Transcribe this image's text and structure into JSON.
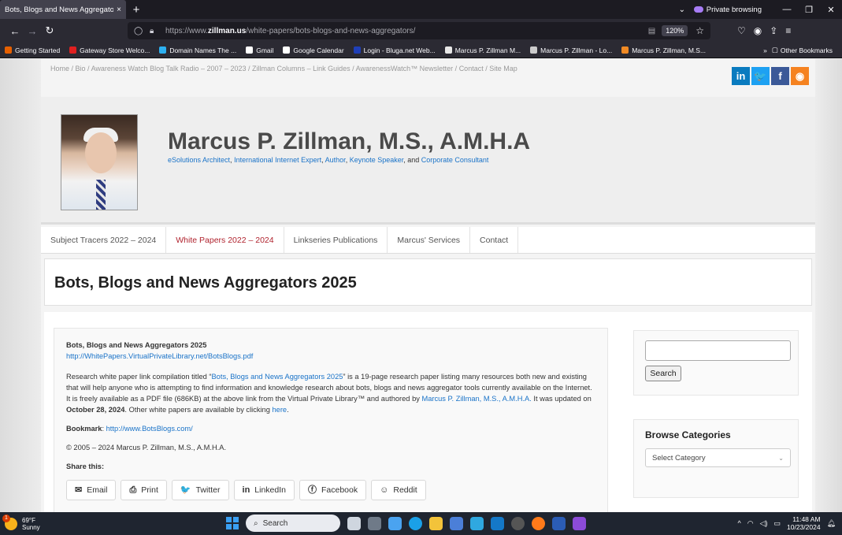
{
  "browser": {
    "tab_title": "Bots, Blogs and News Aggregators",
    "tab_close": "×",
    "new_tab": "+",
    "private_label": "Private browsing",
    "url_prefix": "https://www.",
    "url_domain": "zillman.us",
    "url_path": "/white-papers/bots-blogs-and-news-aggregators/",
    "zoom": "120%",
    "bookmarks": [
      {
        "label": "Getting Started",
        "color": "#e66000"
      },
      {
        "label": "Gateway Store Welco...",
        "color": "#e02020"
      },
      {
        "label": "Domain Names The ...",
        "color": "#2db0f0"
      },
      {
        "label": "Gmail",
        "color": "#ffffff"
      },
      {
        "label": "Google Calendar",
        "color": "#ffffff"
      },
      {
        "label": "Login - Bluga.net Web...",
        "color": "#1f3fb8"
      },
      {
        "label": "Marcus P. Zillman M...",
        "color": "#e8e8e8"
      },
      {
        "label": "Marcus P. Zillman - Lo...",
        "color": "#cccccc"
      },
      {
        "label": "Marcus P. Zillman, M.S...",
        "color": "#f08a24"
      }
    ],
    "other_bookmarks": "Other Bookmarks"
  },
  "site": {
    "topnav": [
      "Home",
      "Bio",
      "Awareness Watch Blog Talk Radio – 2007 – 2023",
      "Zillman Columns – Link Guides",
      "AwarenessWatch™ Newsletter",
      "Contact",
      "Site Map"
    ],
    "social": [
      {
        "name": "linkedin-icon",
        "glyph": "in",
        "color": "#0a7bbf"
      },
      {
        "name": "twitter-icon",
        "glyph": "🐦",
        "color": "#1da1f2"
      },
      {
        "name": "facebook-icon",
        "glyph": "f",
        "color": "#3b5998"
      },
      {
        "name": "rss-icon",
        "glyph": "◉",
        "color": "#f58220"
      }
    ],
    "title": "Marcus P. Zillman, M.S., A.M.H.A",
    "tagline": {
      "t1": "eSolutions Architect",
      "sep1": ", ",
      "t2": "International Internet Expert",
      "sep2": ", ",
      "t3": "Author",
      "sep3": ", ",
      "t4": "Keynote Speaker",
      "sep4": ", and ",
      "t5": "Corporate Consultant"
    },
    "menu": [
      {
        "label": "Subject Tracers 2022 – 2024",
        "active": false
      },
      {
        "label": "White Papers 2022 – 2024",
        "active": true
      },
      {
        "label": "Linkseries Publications",
        "active": false
      },
      {
        "label": "Marcus' Services",
        "active": false
      },
      {
        "label": "Contact",
        "active": false
      }
    ]
  },
  "page": {
    "heading": "Bots, Blogs and News Aggregators 2025",
    "post_title": "Bots, Blogs and News Aggregators 2025",
    "post_link": "http://WhitePapers.VirtualPrivateLibrary.net/BotsBlogs.pdf",
    "para": {
      "a": "Research white paper link compilation titled “",
      "link1": "Bots, Blogs and News Aggregators 2025",
      "b": "” is a 19-page research paper listing many resources both new and existing that will help anyone who is attempting to find information and knowledge research about bots, blogs and news aggregator tools currently available on the Internet. It is  freely available as a PDF file (686KB) at the above link from the Virtual  Private Library™ and authored by ",
      "link2": "Marcus P. Zillman, M.S., A.M.H.A.",
      "c": " It was updated on ",
      "date": "October 28, 2024",
      "d": ". Other  white papers are available by clicking ",
      "link3": "here",
      "e": "."
    },
    "bookmark_label": "Bookmark",
    "bookmark_sep": ": ",
    "bookmark_url": "http://www.BotsBlogs.com/",
    "copyright": "© 2005 –  2024 Marcus P. Zillman, M.S., A.M.H.A.",
    "share_heading": "Share this:",
    "share_buttons": [
      {
        "name": "share-email-button",
        "icon_name": "email-icon",
        "glyph": "✉",
        "label": "Email"
      },
      {
        "name": "share-print-button",
        "icon_name": "print-icon",
        "glyph": "⎙",
        "label": "Print"
      },
      {
        "name": "share-twitter-button",
        "icon_name": "twitter-icon",
        "glyph": "🐦",
        "label": "Twitter"
      },
      {
        "name": "share-linkedin-button",
        "icon_name": "linkedin-icon",
        "glyph": "in",
        "label": "LinkedIn"
      },
      {
        "name": "share-facebook-button",
        "icon_name": "facebook-icon",
        "glyph": "ⓕ",
        "label": "Facebook"
      },
      {
        "name": "share-reddit-button",
        "icon_name": "reddit-icon",
        "glyph": "☺",
        "label": "Reddit"
      }
    ]
  },
  "sidebar": {
    "search_value": "",
    "search_button": "Search",
    "categories_title": "Browse Categories",
    "categories_selected": "Select Category"
  },
  "taskbar": {
    "temp": "69°F",
    "condition": "Sunny",
    "weather_badge": "1",
    "search_placeholder": "Search",
    "time": "11:48 AM",
    "date": "10/23/2024"
  }
}
